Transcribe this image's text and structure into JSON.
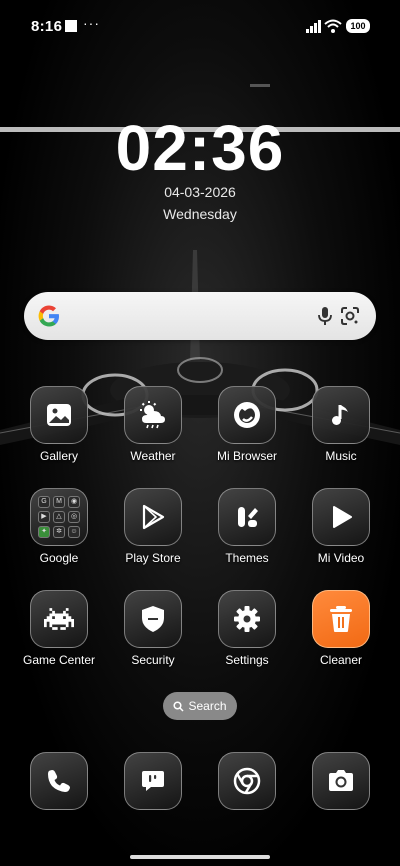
{
  "status_bar": {
    "time": "8:16",
    "dots": "···",
    "battery": "100"
  },
  "clock": {
    "time": "02:36",
    "date": "04-03-2026",
    "day": "Wednesday"
  },
  "search_bar": {
    "google_icon": "google-g-icon",
    "mic_icon": "mic-icon",
    "lens_icon": "lens-icon"
  },
  "apps": [
    {
      "label": "Gallery",
      "icon": "gallery-icon"
    },
    {
      "label": "Weather",
      "icon": "weather-icon"
    },
    {
      "label": "Mi Browser",
      "icon": "browser-icon"
    },
    {
      "label": "Music",
      "icon": "music-icon"
    },
    {
      "label": "Google",
      "icon": "google-folder-icon"
    },
    {
      "label": "Play Store",
      "icon": "play-store-icon"
    },
    {
      "label": "Themes",
      "icon": "themes-icon"
    },
    {
      "label": "Mi Video",
      "icon": "video-icon"
    },
    {
      "label": "Game Center",
      "icon": "game-icon"
    },
    {
      "label": "Security",
      "icon": "shield-icon"
    },
    {
      "label": "Settings",
      "icon": "gear-icon"
    },
    {
      "label": "Cleaner",
      "icon": "trash-icon"
    }
  ],
  "search_pill": {
    "label": "Search"
  },
  "dock": [
    {
      "name": "phone",
      "icon": "phone-icon"
    },
    {
      "name": "messages",
      "icon": "message-icon"
    },
    {
      "name": "chrome",
      "icon": "chrome-icon"
    },
    {
      "name": "camera",
      "icon": "camera-icon"
    }
  ],
  "colors": {
    "cleaner_accent": "#f2711c",
    "background": "#000000"
  }
}
